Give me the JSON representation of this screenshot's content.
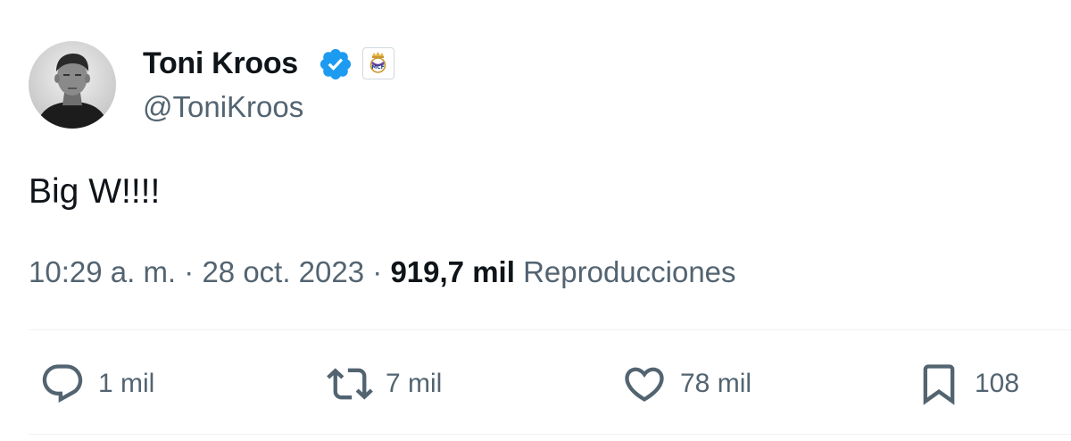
{
  "author": {
    "display_name": "Toni Kroos",
    "handle": "@ToniKroos",
    "verified_icon": "verified-badge-icon",
    "affiliation_icon": "real-madrid-crest-icon"
  },
  "tweet": {
    "text": "Big W!!!!",
    "time": "10:29 a. m.",
    "separator": "·",
    "date": "28 oct. 2023",
    "views_count": "919,7 mil",
    "views_label": "Reproducciones"
  },
  "actions": {
    "reply_count": "1 mil",
    "retweet_count": "7 mil",
    "like_count": "78 mil",
    "bookmark_count": "108"
  },
  "colors": {
    "text_primary": "#0f1419",
    "text_secondary": "#536471",
    "verified_blue": "#1d9bf0",
    "divider": "#eff3f4"
  }
}
